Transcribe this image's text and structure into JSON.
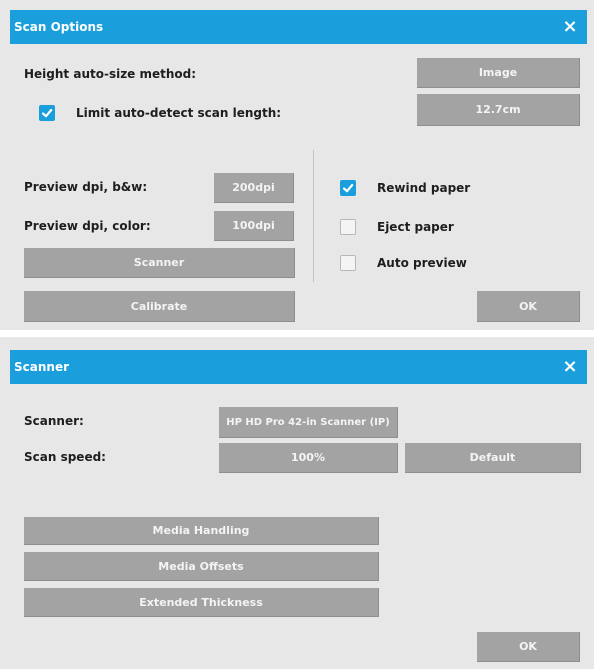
{
  "scan_options": {
    "title": "Scan Options",
    "close_icon": "×",
    "height_autosize_label": "Height auto-size method:",
    "height_autosize_value": "Image",
    "limit_autodetect_label": "Limit auto-detect scan length:",
    "limit_autodetect_checked": true,
    "limit_autodetect_value": "12.7cm",
    "preview_bw_label": "Preview dpi, b&w:",
    "preview_bw_value": "200dpi",
    "preview_color_label": "Preview dpi, color:",
    "preview_color_value": "100dpi",
    "scanner_button": "Scanner",
    "calibrate_button": "Calibrate",
    "ok_button": "OK",
    "rewind_label": "Rewind paper",
    "rewind_checked": true,
    "eject_label": "Eject paper",
    "eject_checked": false,
    "auto_preview_label": "Auto preview",
    "auto_preview_checked": false
  },
  "scanner": {
    "title": "Scanner",
    "close_icon": "×",
    "scanner_label": "Scanner:",
    "scanner_value": "HP HD Pro 42-in Scanner (IP)",
    "speed_label": "Scan speed:",
    "speed_value": "100%",
    "default_button": "Default",
    "media_handling_button": "Media Handling",
    "media_offsets_button": "Media Offsets",
    "extended_thickness_button": "Extended Thickness",
    "ok_button": "OK"
  },
  "colors": {
    "accent": "#1a9fdc",
    "panel": "#e7e7e7",
    "button": "#a3a3a3"
  }
}
